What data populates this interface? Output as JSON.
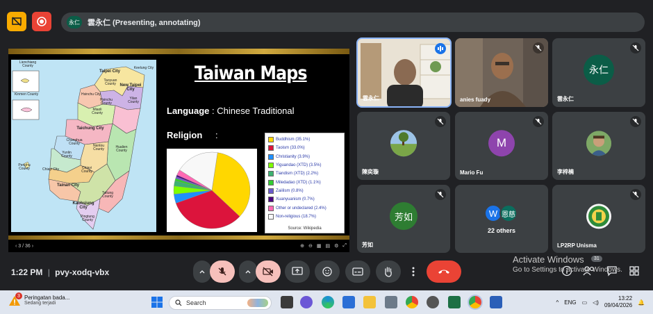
{
  "presenting_banner": {
    "avatar_text": "永仁",
    "label": "雲永仁 (Presenting, annotating)"
  },
  "slide": {
    "title": "Taiwan Maps",
    "language_label": "Language",
    "language_value": " : Chinese Traditional",
    "religion_label": "Religion",
    "religion_colon": ":",
    "legend_source": "Source: Wikipedia",
    "page_indicator": "3 / 36",
    "map_labels": {
      "taipei": "Taipei City",
      "keelung": "Keelung City",
      "taoyuan": "Taoyuan County",
      "new_taipei": "New Taipei City",
      "hsinchu_city": "Hsinchu City",
      "hsinchu_county": "Hsinchu County",
      "yilan": "Yilan County",
      "lienchiang": "Lienchiang County",
      "kinmen": "Kinmen County",
      "miaoli": "Miaoli County",
      "taichung": "Taichung City",
      "changhua": "Changhua County",
      "nantou": "Nantou County",
      "hualien": "Hualien County",
      "yunlin": "Yunlin County",
      "penghu": "Penghu County",
      "chiayi_city": "Chiayi City",
      "chiayi_county": "Chiayi County",
      "tainan": "Tainan City",
      "taitung": "Taitung County",
      "kaohsiung": "Kaohsiung City",
      "pingtung": "Pingtung County"
    }
  },
  "chart_data": {
    "type": "pie",
    "title": "",
    "slices": [
      {
        "label": "Buddhism (35.1%)",
        "value": 35.1,
        "color": "#ffd700"
      },
      {
        "label": "Taoism (33.0%)",
        "value": 33.0,
        "color": "#dc143c"
      },
      {
        "label": "Christianity (3.9%)",
        "value": 3.9,
        "color": "#1e90ff"
      },
      {
        "label": "Yiguandao (XTD) (3.5%)",
        "value": 3.5,
        "color": "#7fff00"
      },
      {
        "label": "Tiandism (XTD) (2.2%)",
        "value": 2.2,
        "color": "#3cb371"
      },
      {
        "label": "Miledadao (XTD) (1.1%)",
        "value": 1.1,
        "color": "#32cd32"
      },
      {
        "label": "Zaiilism (0.8%)",
        "value": 0.8,
        "color": "#6a5acd"
      },
      {
        "label": "Xuanyuanism (0.7%)",
        "value": 0.7,
        "color": "#4b0082"
      },
      {
        "label": "Other or undeclared (2.4%)",
        "value": 2.4,
        "color": "#ff69b4"
      },
      {
        "label": "Non-religious (18.7%)",
        "value": 18.7,
        "color": "#f8f8f8"
      }
    ],
    "legend_placement": "right"
  },
  "participants": [
    {
      "name": "雲永仁",
      "type": "video"
    },
    {
      "name": "anies fuady",
      "type": "video",
      "muted": true
    },
    {
      "name": "雲永仁",
      "type": "avatar",
      "initials": "永仁",
      "color": "#0b5d47",
      "muted": true
    },
    {
      "name": "陳奕璇",
      "type": "photo",
      "muted": true
    },
    {
      "name": "Mario Fu",
      "type": "avatar",
      "initials": "M",
      "color": "#8e44ad",
      "muted": true
    },
    {
      "name": "李梓楠",
      "type": "photo",
      "muted": true
    },
    {
      "name": "芳如",
      "type": "avatar",
      "initials": "芳如",
      "color": "#2e7d32",
      "muted": true
    },
    {
      "name": "22 others",
      "type": "group",
      "initials_a": "W",
      "initials_b": "恩慈"
    },
    {
      "name": "LP2RP Unisma",
      "type": "photo",
      "muted": true
    }
  ],
  "bottom_bar": {
    "time": "1:22 PM",
    "separator": "|",
    "meeting_code": "pvy-xodq-vbx",
    "activate_title": "Activate Windows",
    "activate_sub": "Go to Settings to activate Windows.",
    "chat_badge": "31"
  },
  "taskbar": {
    "notif_count": "3",
    "notif_title": "Peringatan bada...",
    "notif_sub": "Sedang terjadi",
    "search_placeholder": "Search",
    "lang": "ENG",
    "time": "13:22",
    "date": "09/04/2026"
  }
}
